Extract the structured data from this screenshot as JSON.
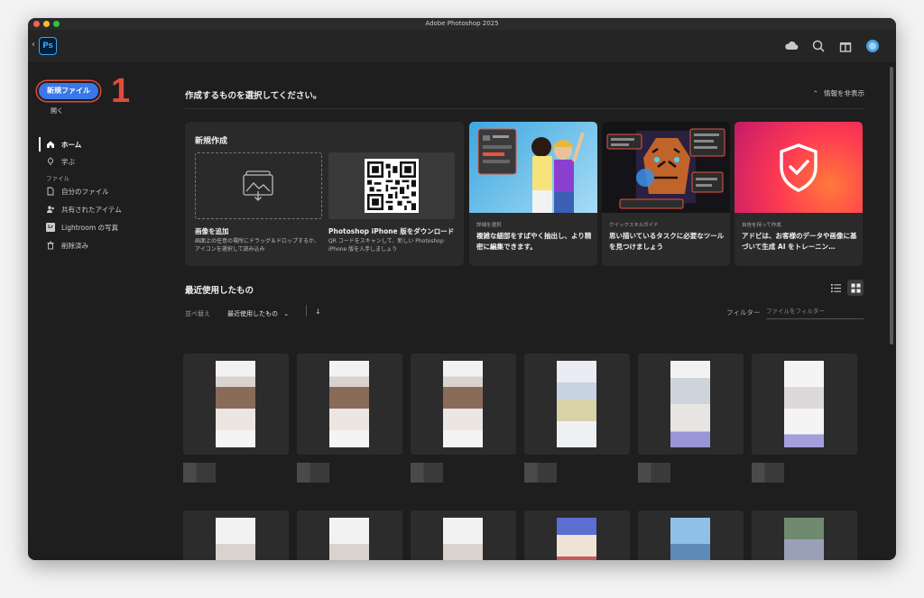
{
  "window": {
    "title": "Adobe Photoshop 2025"
  },
  "app": {
    "logo_text": "Ps",
    "back_glyph": "‹"
  },
  "appbar_icons": [
    "cloud-icon",
    "search-icon",
    "gift-icon",
    "avatar"
  ],
  "sidebar": {
    "new_file_label": "新規ファイル",
    "step_number": "1",
    "open_label": "開く",
    "items": [
      {
        "label": "ホーム",
        "icon": "home-icon",
        "active": true
      },
      {
        "label": "学ぶ",
        "icon": "lightbulb-icon",
        "active": false
      }
    ],
    "files_heading": "ファイル",
    "file_items": [
      {
        "label": "自分のファイル",
        "icon": "file-icon"
      },
      {
        "label": "共有されたアイテム",
        "icon": "shared-icon"
      },
      {
        "label": "Lightroom の写真",
        "icon": "lightroom-icon",
        "icon_text": "Lr"
      },
      {
        "label": "削除済み",
        "icon": "trash-icon"
      }
    ]
  },
  "main": {
    "heading": "作成するものを選択してください。",
    "hide_info": "情報を非表示",
    "hide_info_glyph": "⌃",
    "new_section": {
      "title": "新規作成",
      "add_image_title": "画像を追加",
      "add_image_desc": "画面上の任意の場所にドラッグ＆ドロップするか、アイコンを選択して読み込み",
      "iphone_title": "Photoshop iPhone 版をダウンロード",
      "iphone_desc": "QR コードをスキャンして、新しい Photoshop iPhone 版を入手しましょう"
    },
    "promos": [
      {
        "tag": "詳細を選択",
        "desc": "複雑な細部をすばやく抽出し、より精密に編集できます。"
      },
      {
        "tag": "クイックスキルガイド",
        "desc": "思い描いているタスクに必要なツールを見つけましょう"
      },
      {
        "tag": "自信を持って作成",
        "desc": "アドビは、お客様のデータや画像に基づいて生成 AI をトレーニン…"
      }
    ],
    "recent": {
      "heading": "最近使用したもの",
      "sort_label": "並べ替え",
      "sort_value": "最近使用したもの",
      "sort_chevron": "⌄",
      "sort_direction": "↓",
      "filter_label": "フィルター",
      "filter_placeholder": "ファイルをフィルター"
    }
  },
  "colors": {
    "accent": "#3b78e7",
    "highlight": "#e14a3b",
    "background": "#1e1e1e",
    "card": "#2a2a2a"
  }
}
